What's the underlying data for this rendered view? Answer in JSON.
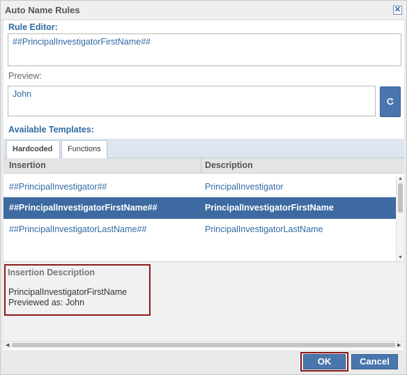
{
  "dialog": {
    "title": "Auto Name Rules",
    "close_glyph": "✕"
  },
  "rule_editor": {
    "label": "Rule Editor:",
    "value": "##PrincipalInvestigatorFirstName##"
  },
  "preview": {
    "label": "Preview:",
    "value": "John",
    "refresh_icon": "refresh-icon"
  },
  "templates": {
    "label": "Available Templates:",
    "tabs": [
      {
        "label": "Hardcoded",
        "active": true
      },
      {
        "label": "Functions",
        "active": false
      }
    ],
    "columns": [
      "Insertion",
      "Description"
    ],
    "rows": [
      {
        "insertion": "##PrincipalInvestigator##",
        "description": "PrincipalInvestigator",
        "selected": false
      },
      {
        "insertion": "##PrincipalInvestigatorFirstName##",
        "description": "PrincipalInvestigatorFirstName",
        "selected": true
      },
      {
        "insertion": "##PrincipalInvestigatorLastName##",
        "description": "PrincipalInvestigatorLastName",
        "selected": false
      }
    ]
  },
  "insertion_description": {
    "heading": "Insertion Description",
    "line1": "PrincipalInvestigatorFirstName",
    "line2": "Previewed as: John"
  },
  "footer": {
    "ok_label": "OK",
    "cancel_label": "Cancel"
  },
  "colors": {
    "accent": "#4a76ae",
    "selected_row": "#3d6aa1",
    "highlight": "#8b1a1a",
    "link_text": "#2f6aa3"
  }
}
